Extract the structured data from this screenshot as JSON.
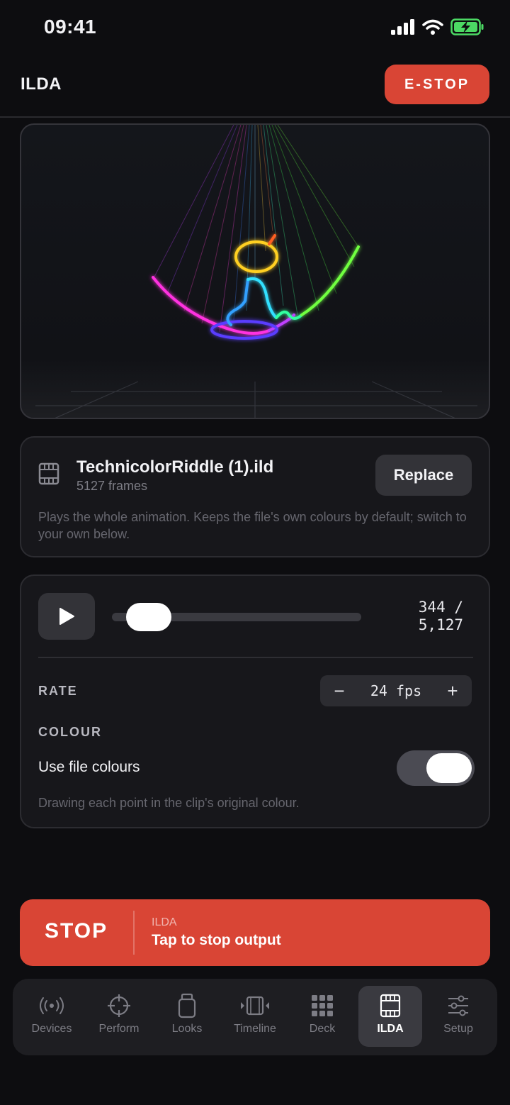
{
  "status_bar": {
    "time": "09:41"
  },
  "header": {
    "title": "ILDA",
    "estop_label": "E-STOP"
  },
  "file": {
    "name": "TechnicolorRiddle (1).ild",
    "frames_label": "5127 frames",
    "replace_label": "Replace",
    "description": "Plays the whole animation. Keeps the file's own colours by default; switch to your own below."
  },
  "playback": {
    "frame_current": "344 /",
    "frame_total": "5,127",
    "progress_fraction": 0.067,
    "rate_label": "RATE",
    "rate_value": "24 fps",
    "rate_minus": "−",
    "rate_plus": "+",
    "colour_label": "COLOUR",
    "use_file_colours_label": "Use file colours",
    "use_file_colours_on": true,
    "colour_note": "Drawing each point in the clip's original colour."
  },
  "stop_bar": {
    "label": "STOP",
    "mode": "ILDA",
    "hint": "Tap to stop output"
  },
  "tabs": [
    {
      "label": "Devices",
      "icon": "broadcast-icon",
      "active": false
    },
    {
      "label": "Perform",
      "icon": "crosshair-icon",
      "active": false
    },
    {
      "label": "Looks",
      "icon": "cup-icon",
      "active": false
    },
    {
      "label": "Timeline",
      "icon": "timeline-icon",
      "active": false
    },
    {
      "label": "Deck",
      "icon": "grid-icon",
      "active": false
    },
    {
      "label": "ILDA",
      "icon": "film-icon",
      "active": true
    },
    {
      "label": "Setup",
      "icon": "sliders-icon",
      "active": false
    }
  ],
  "colors": {
    "accent_red": "#d94535",
    "background": "#0d0d10",
    "card": "#17171b"
  }
}
